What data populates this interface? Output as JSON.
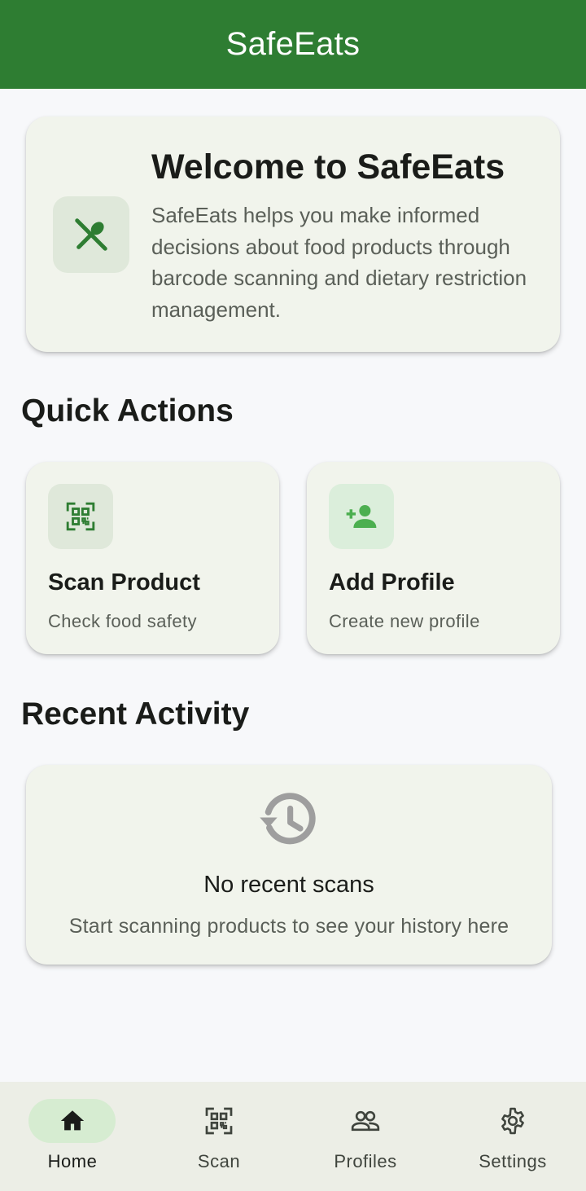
{
  "app_bar": {
    "title": "SafeEats"
  },
  "welcome": {
    "icon": "restaurant-icon",
    "title": "Welcome to SafeEats",
    "description": "SafeEats helps you make informed decisions about food products through barcode scanning and dietary restriction management."
  },
  "quick_actions": {
    "title": "Quick Actions",
    "items": [
      {
        "icon": "qr-scanner-icon",
        "title": "Scan Product",
        "subtitle": "Check food safety"
      },
      {
        "icon": "person-add-icon",
        "title": "Add Profile",
        "subtitle": "Create new profile"
      }
    ]
  },
  "recent_activity": {
    "title": "Recent Activity",
    "icon": "history-icon",
    "empty_title": "No recent scans",
    "empty_subtitle": "Start scanning products to see your history here"
  },
  "bottom_nav": {
    "items": [
      {
        "icon": "home-icon",
        "label": "Home",
        "active": true
      },
      {
        "icon": "qr-scanner-icon",
        "label": "Scan",
        "active": false
      },
      {
        "icon": "people-icon",
        "label": "Profiles",
        "active": false
      },
      {
        "icon": "gear-icon",
        "label": "Settings",
        "active": false
      }
    ]
  },
  "colors": {
    "primary": "#2e7d32",
    "accent_light": "#4caf50",
    "background": "#f7f8fa",
    "card": "#f1f4ec",
    "nav_bg": "#eceee6",
    "nav_active_pill": "#d6ecd1"
  }
}
